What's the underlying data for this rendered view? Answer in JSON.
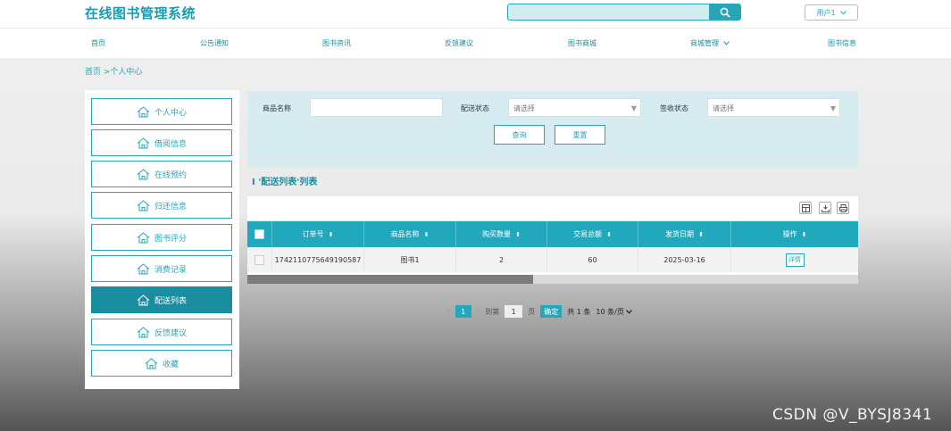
{
  "header": {
    "site_title": "在线图书管理系统",
    "user_label": "用户1"
  },
  "nav": [
    "首页",
    "公告通知",
    "图书资讯",
    "反馈建议",
    "图书商城",
    "商城管理",
    "图书信息"
  ],
  "breadcrumb": "首页 >个人中心",
  "sidebar": {
    "items": [
      "个人中心",
      "借阅信息",
      "在线预约",
      "归还信息",
      "图书评分",
      "消费记录",
      "配送列表",
      "反馈建议",
      "收藏"
    ],
    "active": "配送列表"
  },
  "filter": {
    "product_name_label": "商品名称",
    "product_name_value": "",
    "delivery_status_label": "配送状态",
    "delivery_status_value": "请选择",
    "receipt_status_label": "签收状态",
    "receipt_status_value": "请选择",
    "query_label": "查询",
    "reset_label": "重置"
  },
  "list": {
    "title": "I '配送列表'列表",
    "columns": [
      "订单号",
      "商品名称",
      "购买数量",
      "交易总额",
      "发货日期",
      "操作"
    ],
    "rows": [
      {
        "order_no": "1742110775649190587",
        "product": "图书1",
        "qty": "2",
        "total": "60",
        "ship_date": "2025-03-16",
        "action": "详情"
      }
    ]
  },
  "pagination": {
    "prev": "‹",
    "current": "1",
    "next": "›",
    "goto_label": "到第",
    "goto_value": "1",
    "page_label": "页",
    "confirm_label": "确定",
    "total_label": "共 1 条",
    "page_size": "10 条/页"
  },
  "watermark": "CSDN @V_BYSJ8341",
  "colors": {
    "accent": "#22a8bd",
    "active_sidebar": "#1a8ea0",
    "filter_bg": "#d6ecf0"
  }
}
